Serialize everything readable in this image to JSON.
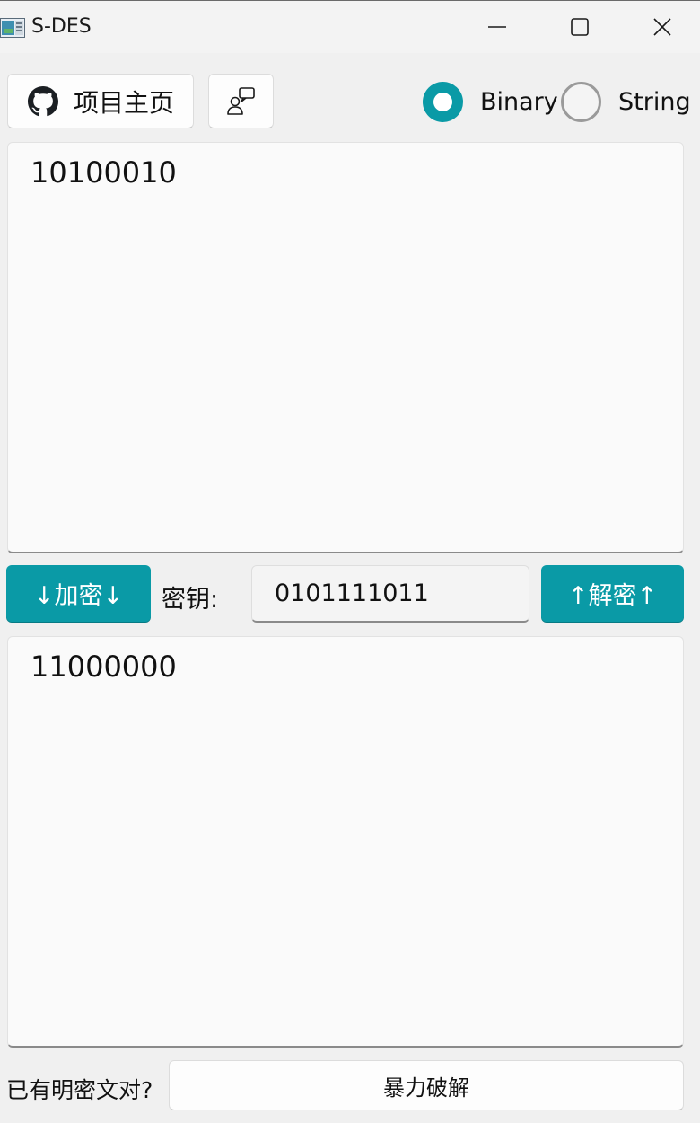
{
  "window": {
    "title": "S-DES"
  },
  "toolbar": {
    "home_label": "项目主页",
    "format_options": [
      {
        "label": "Binary",
        "selected": true
      },
      {
        "label": "String",
        "selected": false
      }
    ]
  },
  "input": {
    "text": "10100010"
  },
  "controls": {
    "encrypt_label": "↓加密↓",
    "key_label": "密钥:",
    "key_value": "0101111011",
    "decrypt_label": "↑解密↑"
  },
  "output": {
    "text": "11000000"
  },
  "footer": {
    "pair_question": "已有明密文对?",
    "brute_force_label": "暴力破解"
  },
  "colors": {
    "accent": "#0a9aa6"
  }
}
